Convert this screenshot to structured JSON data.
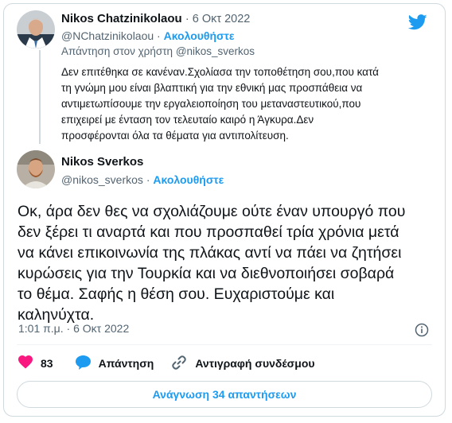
{
  "reply_tweet": {
    "author_name": "Nikos Chatzinikolaou",
    "separator": "·",
    "date": "6 Οκτ 2022",
    "handle": "@NChatzinikolaou",
    "follow_label": "Ακολουθήστε",
    "reply_prefix": "Απάντηση στον χρήστη",
    "reply_to": "@nikos_sverkos",
    "lines": [
      "Δεν επιτέθηκα σε κανέναν.Σχολίασα την τοποθέτηση σου,που κατά",
      "τη γνώμη μου είναι βλαπτική για την εθνική μας προσπάθεια να",
      "αντιμετωπίσουμε την εργαλειοποίηση του μεταναστευτικού,που",
      "επιχειρεί με ένταση τον τελευταίο καιρό η Άγκυρα.Δεν",
      "προσφέρονται όλα τα θέματα για αντιπολίτευση."
    ]
  },
  "main_tweet": {
    "author_name": "Nikos Sverkos",
    "handle": "@nikos_sverkos",
    "follow_label": "Ακολουθήστε",
    "lines": [
      "Οκ, άρα δεν θες να σχολιάζουμε ούτε έναν υπουργό που",
      "δεν ξέρει τι αναρτά και που προσπαθεί τρία χρόνια μετά",
      "να κάνει επικοινωνία της πλάκας αντί να πάει να ζητήσει",
      "κυρώσεις για την Τουρκία και να διεθνοποιήσει σοβαρά",
      "το θέμα. Σαφής η θέση σου. Ευχαριστούμε και",
      "καληνύχτα."
    ],
    "time": "1:01 π.μ.",
    "date": "6 Οκτ 2022",
    "like_count": "83",
    "reply_label": "Απάντηση",
    "copy_link_label": "Αντιγραφή συνδέσμου",
    "read_replies_label": "Ανάγνωση 34 απαντήσεων"
  },
  "colors": {
    "accent": "#1d9bf0",
    "like": "#f91880",
    "muted": "#536471",
    "text": "#0f1419",
    "border": "#cfd9de"
  },
  "icons": [
    "twitter-logo-icon",
    "heart-icon",
    "reply-bubble-icon",
    "link-icon",
    "info-icon"
  ]
}
